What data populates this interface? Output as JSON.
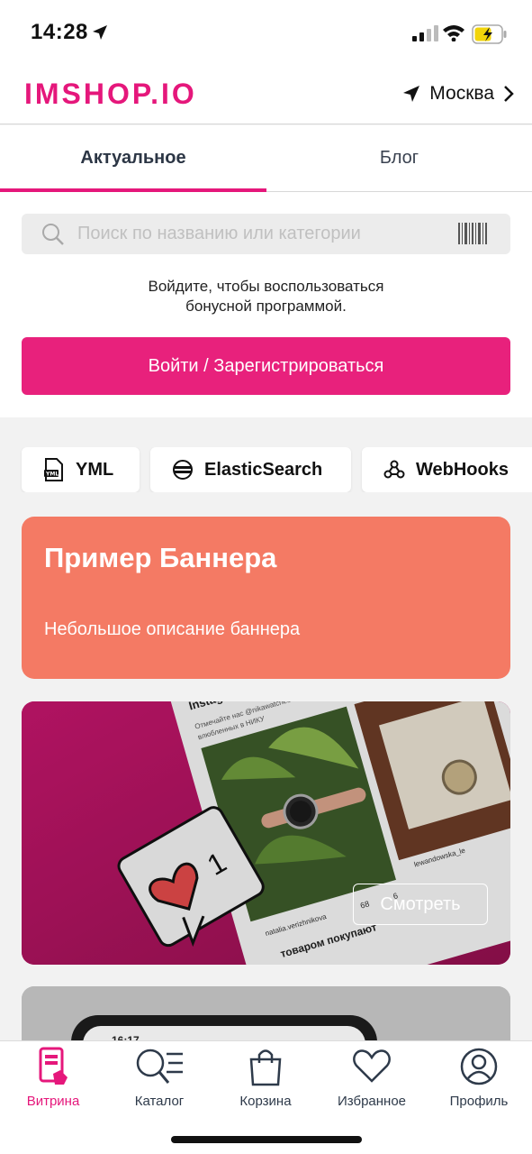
{
  "status_bar": {
    "time": "14:28"
  },
  "header": {
    "logo": "IMSHOP.IO",
    "city": "Москва"
  },
  "tabs": [
    {
      "label": "Актуальное",
      "active": true
    },
    {
      "label": "Блог",
      "active": false
    }
  ],
  "search": {
    "placeholder": "Поиск по названию или категории"
  },
  "login_prompt": {
    "line1": "Войдите, чтобы воспользоваться",
    "line2": "бонусной программой.",
    "button": "Войти / Зарегистрироваться"
  },
  "chips": [
    {
      "label": "YML",
      "icon": "file-yml-icon"
    },
    {
      "label": "ElasticSearch",
      "icon": "elasticsearch-icon"
    },
    {
      "label": "WebHooks",
      "icon": "webhooks-icon"
    }
  ],
  "banner1": {
    "title": "Пример Баннера",
    "description": "Небольшое описание баннера",
    "color": "#f47a64"
  },
  "banner2": {
    "button": "Смотреть",
    "image_texts": [
      "Instagram от",
      "Отмечайте нас @nikawatches",
      "влюбленных в НИКУ",
      "natalia.verizhnikova",
      "lewandowska_le",
      "68",
      "6",
      "1",
      "товаром покупают"
    ]
  },
  "banner3": {
    "image_text": "16:17"
  },
  "tabbar": [
    {
      "label": "Витрина",
      "icon": "storefront-icon",
      "active": true
    },
    {
      "label": "Каталог",
      "icon": "catalog-search-icon",
      "active": false
    },
    {
      "label": "Корзина",
      "icon": "shopping-bag-icon",
      "active": false
    },
    {
      "label": "Избранное",
      "icon": "heart-icon",
      "active": false
    },
    {
      "label": "Профиль",
      "icon": "profile-icon",
      "active": false
    }
  ],
  "colors": {
    "accent": "#e5177b",
    "button": "#e8217c"
  }
}
